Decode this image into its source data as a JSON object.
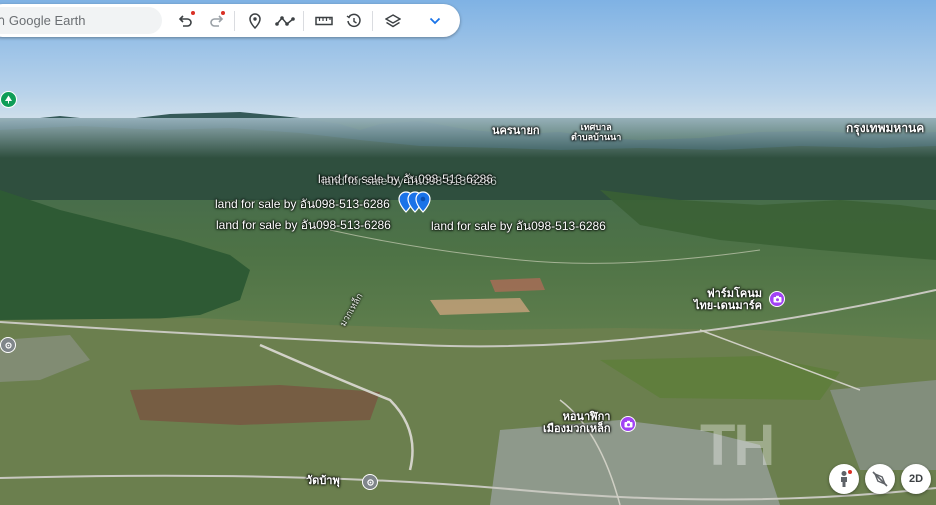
{
  "toolbar": {
    "search_placeholder": "า Google Earth"
  },
  "map_labels": {
    "land_1": "land for sale by อัน098-513-6286",
    "land_2": "land for sale by อัน098-513-6286",
    "land_3": "land for sale by อัน098-513-6286",
    "land_4": "land for sale by อัน098-513-6286",
    "place_1": "นครนายก",
    "place_2_line1": "เทศบาล",
    "place_2_line2": "ตำบลบ้านนา",
    "place_3": "กรุงเทพมหานค",
    "poi_farm_line1": "ฟาร์มโคนม",
    "poi_farm_line2": "ไทย-เดนมาร์ค",
    "poi_tower_line1": "หอนาฬิกา",
    "poi_tower_line2": "เมืองมวกเหล็ก",
    "poi_temple": "วัดบ้าพุ",
    "road_label": "มวกเหล็ก"
  },
  "controls": {
    "mode_2d": "2D"
  },
  "colors": {
    "sky_top": "#8ab9e6",
    "sky_bottom": "#d4e3ee",
    "pin_blue": "#1a73e8",
    "poi_purple": "#a142f4",
    "poi_gray": "#80868b",
    "poi_green": "#0f9d58"
  }
}
